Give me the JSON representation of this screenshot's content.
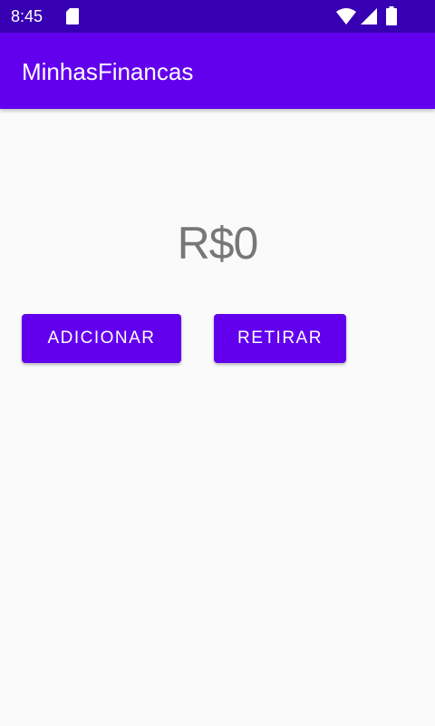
{
  "status_bar": {
    "time": "8:45",
    "icons": [
      "sd-card-icon",
      "wifi-icon",
      "signal-icon",
      "battery-icon"
    ]
  },
  "app_bar": {
    "title": "MinhasFinancas",
    "color": "#6200ee",
    "status_color": "#3700b3"
  },
  "main": {
    "balance": "R$0",
    "buttons": {
      "add_label": "ADICIONAR",
      "withdraw_label": "RETIRAR"
    }
  }
}
